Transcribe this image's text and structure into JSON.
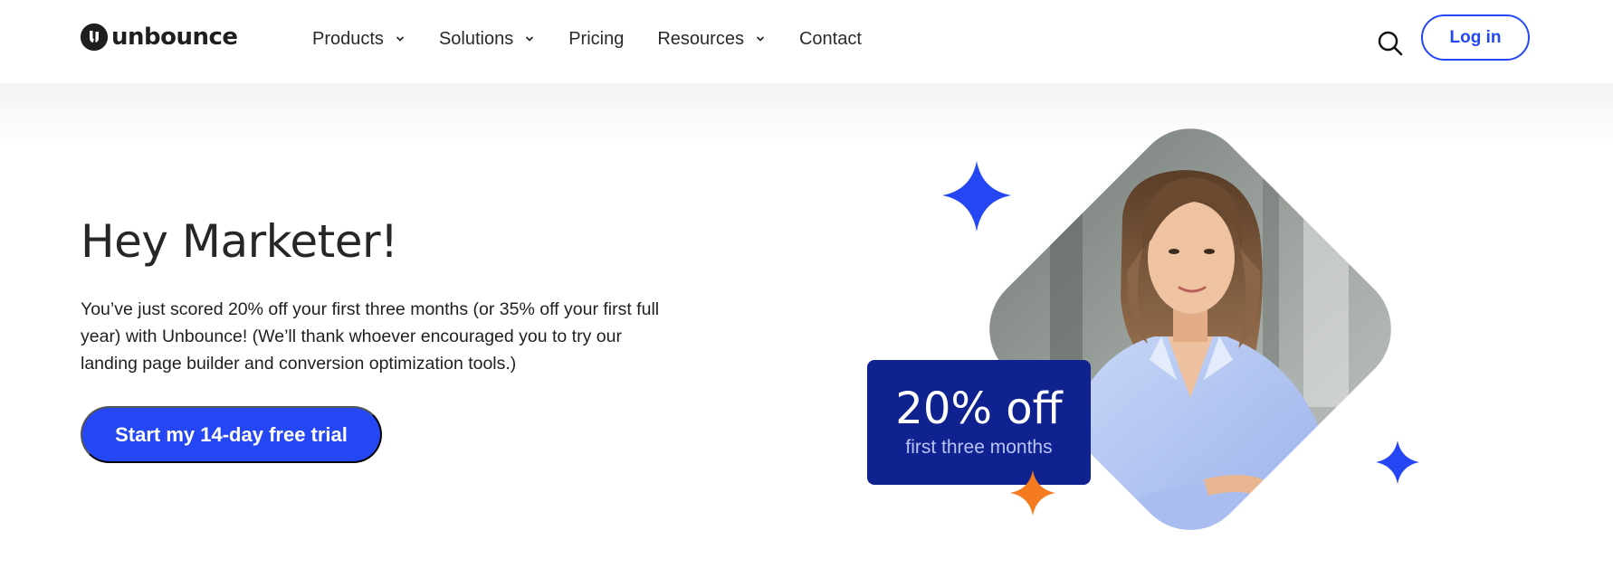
{
  "header": {
    "logo_text": "unbounce",
    "nav": [
      {
        "label": "Products",
        "has_dropdown": true
      },
      {
        "label": "Solutions",
        "has_dropdown": true
      },
      {
        "label": "Pricing",
        "has_dropdown": false
      },
      {
        "label": "Resources",
        "has_dropdown": true
      },
      {
        "label": "Contact",
        "has_dropdown": false
      }
    ],
    "search_icon": "search-icon",
    "login_label": "Log in"
  },
  "hero": {
    "title": "Hey Marketer!",
    "paragraph": "You’ve just scored 20% off your first three months (or 35% off your first full year) with Unbounce! (We’ll thank whoever encouraged you to try our landing page builder and conversion optimization tools.)",
    "cta_label": "Start my 14-day free trial"
  },
  "promo": {
    "badge_main": "20% off",
    "badge_sub": "first three months"
  },
  "colors": {
    "brand_blue": "#2547f3",
    "badge_navy": "#0f2290",
    "accent_orange": "#f47b20"
  }
}
